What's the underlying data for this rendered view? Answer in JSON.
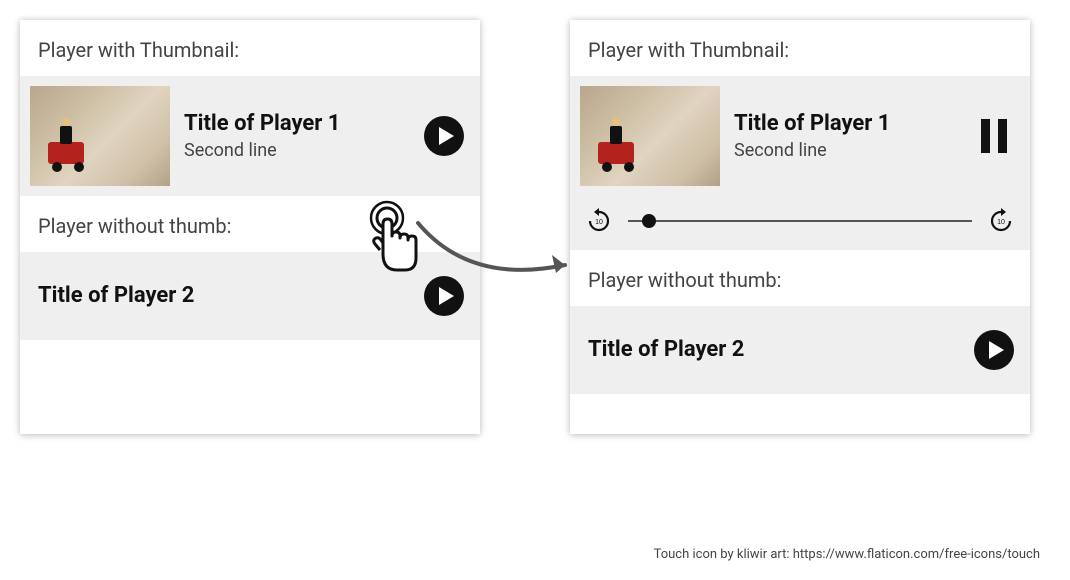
{
  "left": {
    "section1_label": "Player with Thumbnail:",
    "player1": {
      "title": "Title of Player 1",
      "subtitle": "Second line"
    },
    "section2_label": "Player without thumb:",
    "player2": {
      "title": "Title of Player 2"
    }
  },
  "right": {
    "section1_label": "Player with Thumbnail:",
    "player1": {
      "title": "Title of Player 1",
      "subtitle": "Second line"
    },
    "slider": {
      "progress_percent": 6
    },
    "rewind_seconds": "10",
    "forward_seconds": "10",
    "section2_label": "Player without thumb:",
    "player2": {
      "title": "Title of Player 2"
    }
  },
  "attribution": "Touch icon by kliwir art: https://www.flaticon.com/free-icons/touch"
}
